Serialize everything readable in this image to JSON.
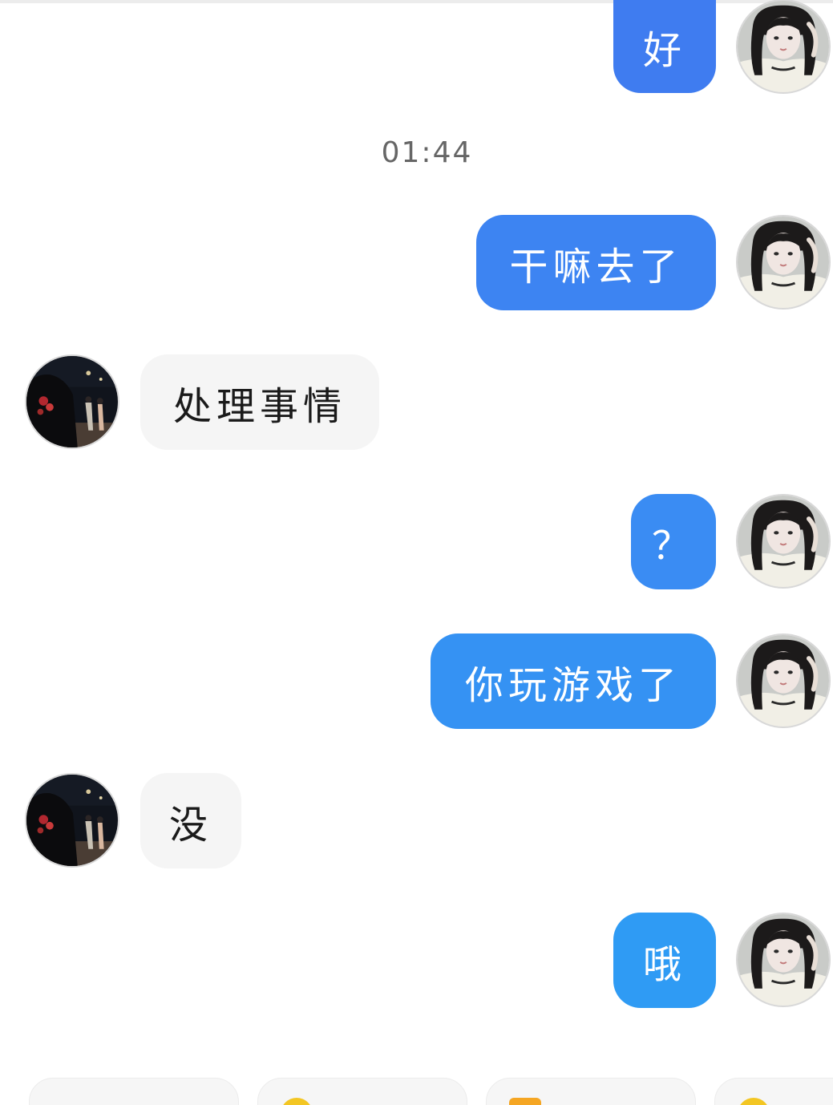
{
  "conversation": {
    "timestamp": "01:44",
    "messages": [
      {
        "side": "outgoing",
        "text": "好",
        "color": "#3f7cf0"
      },
      {
        "side": "outgoing",
        "text": "干嘛去了",
        "color": "#3d84f2"
      },
      {
        "side": "incoming",
        "text": "处理事情"
      },
      {
        "side": "outgoing",
        "text": "？",
        "color": "#3a8cf3"
      },
      {
        "side": "outgoing",
        "text": "你玩游戏了",
        "color": "#3592f3"
      },
      {
        "side": "incoming",
        "text": "没"
      },
      {
        "side": "outgoing",
        "text": "哦",
        "color": "#2f9bf4"
      }
    ]
  },
  "quick_actions": [
    {
      "icon": "flower-icon",
      "label": "",
      "color": "#e85a3a"
    },
    {
      "icon": "smile-emoji-icon",
      "label": "",
      "color": "#f3c623"
    },
    {
      "icon": "gift-icon",
      "label": "",
      "color": "#f5a623"
    },
    {
      "icon": "smile-emoji-icon",
      "label": "",
      "color": "#f3c623"
    }
  ],
  "colors": {
    "incoming_bubble": "#f5f5f5",
    "incoming_text": "#1a1a1a",
    "outgoing_text": "#ffffff",
    "timestamp_text": "#666666"
  }
}
